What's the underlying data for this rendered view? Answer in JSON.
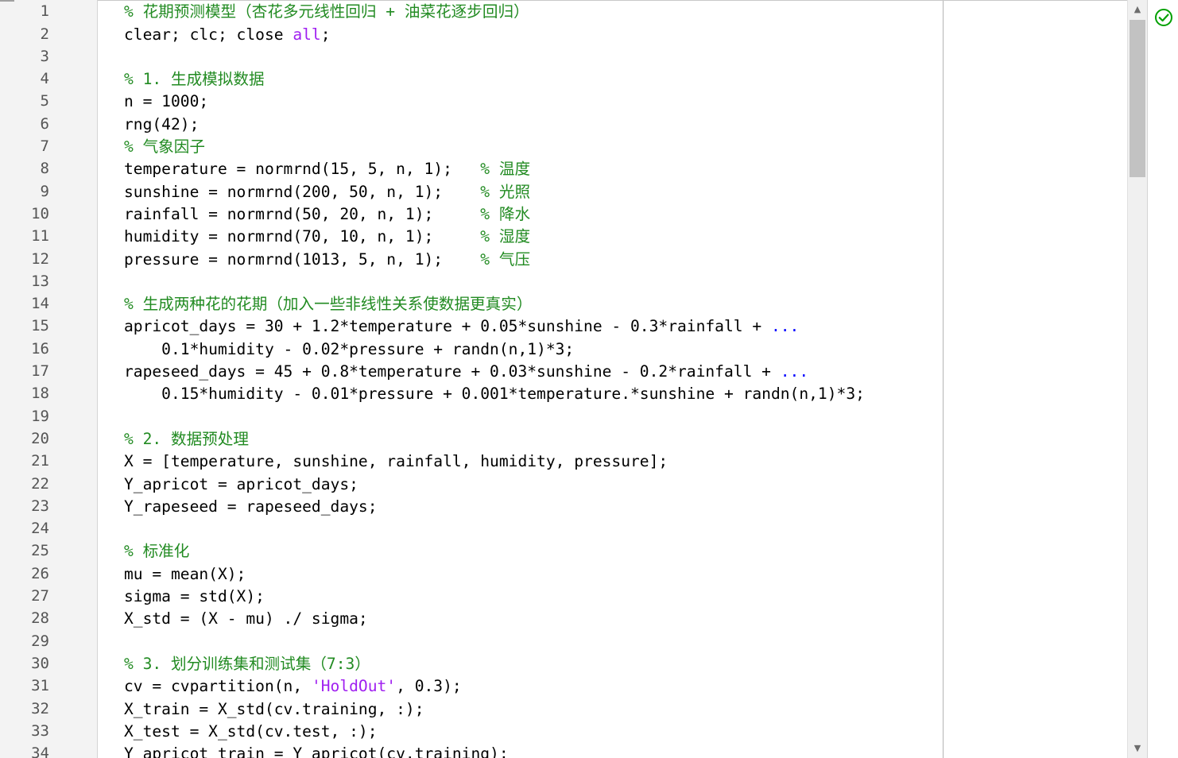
{
  "editor": {
    "scroll_up_glyph": "▲",
    "scroll_down_glyph": "▼",
    "status": "no-warnings",
    "status_icon": "check-circle-icon",
    "status_color": "#00a000",
    "colors": {
      "comment": "#228b22",
      "string": "#a020f0",
      "keyword": "#0000ff",
      "text": "#000000"
    }
  },
  "lines": [
    {
      "num": "1",
      "segs": [
        {
          "t": "% 花期预测模型（杏花多元线性回归 + 油菜花逐步回归）",
          "c": "c"
        }
      ]
    },
    {
      "num": "2",
      "segs": [
        {
          "t": "clear; clc; close ",
          "c": ""
        },
        {
          "t": "all",
          "c": "s"
        },
        {
          "t": ";",
          "c": ""
        }
      ]
    },
    {
      "num": "3",
      "segs": []
    },
    {
      "num": "4",
      "segs": [
        {
          "t": "% 1. 生成模拟数据",
          "c": "c"
        }
      ]
    },
    {
      "num": "5",
      "segs": [
        {
          "t": "n = 1000;",
          "c": ""
        }
      ]
    },
    {
      "num": "6",
      "segs": [
        {
          "t": "rng(42);",
          "c": ""
        }
      ]
    },
    {
      "num": "7",
      "segs": [
        {
          "t": "% 气象因子",
          "c": "c"
        }
      ]
    },
    {
      "num": "8",
      "segs": [
        {
          "t": "temperature = normrnd(15, 5, n, 1);   ",
          "c": ""
        },
        {
          "t": "% 温度",
          "c": "c"
        }
      ]
    },
    {
      "num": "9",
      "segs": [
        {
          "t": "sunshine = normrnd(200, 50, n, 1);    ",
          "c": ""
        },
        {
          "t": "% 光照",
          "c": "c"
        }
      ]
    },
    {
      "num": "10",
      "segs": [
        {
          "t": "rainfall = normrnd(50, 20, n, 1);     ",
          "c": ""
        },
        {
          "t": "% 降水",
          "c": "c"
        }
      ]
    },
    {
      "num": "11",
      "segs": [
        {
          "t": "humidity = normrnd(70, 10, n, 1);     ",
          "c": ""
        },
        {
          "t": "% 湿度",
          "c": "c"
        }
      ]
    },
    {
      "num": "12",
      "segs": [
        {
          "t": "pressure = normrnd(1013, 5, n, 1);    ",
          "c": ""
        },
        {
          "t": "% 气压",
          "c": "c"
        }
      ]
    },
    {
      "num": "13",
      "segs": []
    },
    {
      "num": "14",
      "segs": [
        {
          "t": "% 生成两种花的花期（加入一些非线性关系使数据更真实）",
          "c": "c"
        }
      ]
    },
    {
      "num": "15",
      "segs": [
        {
          "t": "apricot_days = 30 + 1.2*temperature + 0.05*sunshine - 0.3*rainfall + ",
          "c": ""
        },
        {
          "t": "...",
          "c": "k"
        }
      ]
    },
    {
      "num": "16",
      "segs": [
        {
          "t": "    0.1*humidity - 0.02*pressure + randn(n,1)*3;",
          "c": ""
        }
      ]
    },
    {
      "num": "17",
      "segs": [
        {
          "t": "rapeseed_days = 45 + 0.8*temperature + 0.03*sunshine - 0.2*rainfall + ",
          "c": ""
        },
        {
          "t": "...",
          "c": "k"
        }
      ]
    },
    {
      "num": "18",
      "segs": [
        {
          "t": "    0.15*humidity - 0.01*pressure + 0.001*temperature.*sunshine + randn(n,1)*3;",
          "c": ""
        }
      ]
    },
    {
      "num": "19",
      "segs": []
    },
    {
      "num": "20",
      "segs": [
        {
          "t": "% 2. 数据预处理",
          "c": "c"
        }
      ]
    },
    {
      "num": "21",
      "segs": [
        {
          "t": "X = [temperature, sunshine, rainfall, humidity, pressure];",
          "c": ""
        }
      ]
    },
    {
      "num": "22",
      "segs": [
        {
          "t": "Y_apricot = apricot_days;",
          "c": ""
        }
      ]
    },
    {
      "num": "23",
      "segs": [
        {
          "t": "Y_rapeseed = rapeseed_days;",
          "c": ""
        }
      ]
    },
    {
      "num": "24",
      "segs": []
    },
    {
      "num": "25",
      "segs": [
        {
          "t": "% 标准化",
          "c": "c"
        }
      ]
    },
    {
      "num": "26",
      "segs": [
        {
          "t": "mu = mean(X);",
          "c": ""
        }
      ]
    },
    {
      "num": "27",
      "segs": [
        {
          "t": "sigma = std(X);",
          "c": ""
        }
      ]
    },
    {
      "num": "28",
      "segs": [
        {
          "t": "X_std = (X - mu) ./ sigma;",
          "c": ""
        }
      ]
    },
    {
      "num": "29",
      "segs": []
    },
    {
      "num": "30",
      "segs": [
        {
          "t": "% 3. 划分训练集和测试集（7:3）",
          "c": "c"
        }
      ]
    },
    {
      "num": "31",
      "segs": [
        {
          "t": "cv = cvpartition(n, ",
          "c": ""
        },
        {
          "t": "'HoldOut'",
          "c": "s"
        },
        {
          "t": ", 0.3);",
          "c": ""
        }
      ]
    },
    {
      "num": "32",
      "segs": [
        {
          "t": "X_train = X_std(cv.training, :);",
          "c": ""
        }
      ]
    },
    {
      "num": "33",
      "segs": [
        {
          "t": "X_test = X_std(cv.test, :);",
          "c": ""
        }
      ]
    },
    {
      "num": "34",
      "segs": [
        {
          "t": "Y_apricot_train = Y_apricot(cv.training);",
          "c": ""
        }
      ]
    }
  ]
}
